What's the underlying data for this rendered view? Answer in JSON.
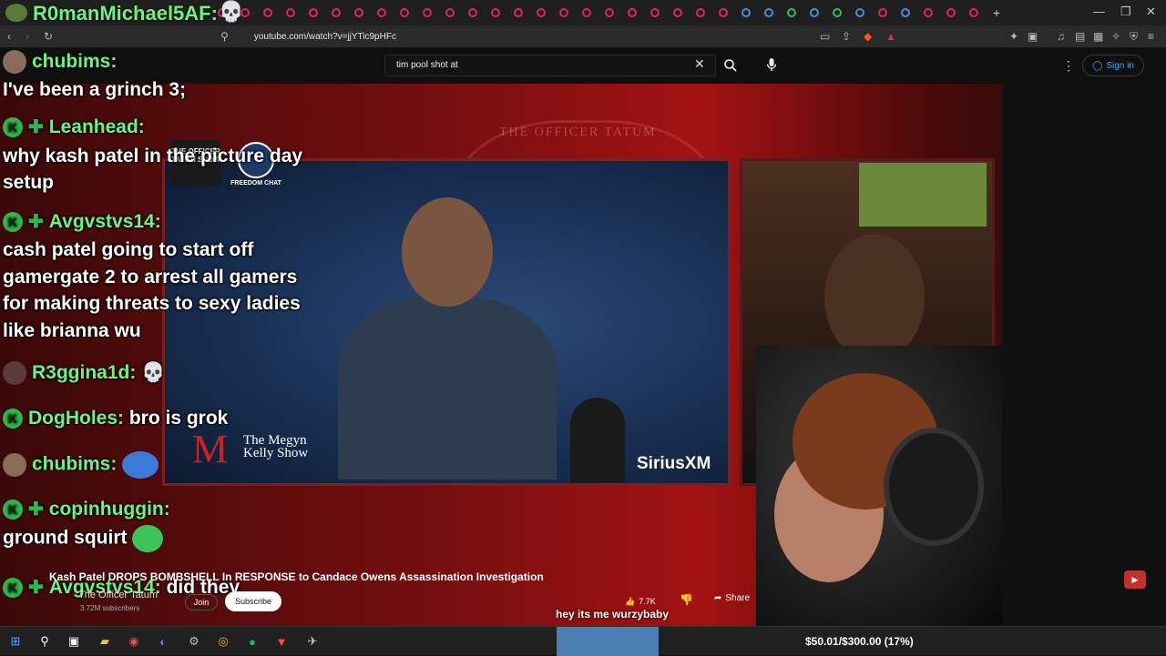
{
  "browser": {
    "url": "youtube.com/watch?v=jjYTic9pHFc",
    "tab_count": 34
  },
  "youtube": {
    "search_value": "tim pool shot at",
    "signin_label": "Sign in",
    "video_title": "Kash Patel DROPS BOMBSHELL In RESPONSE to Candace Owens Assassination Investigation",
    "channel_name": "The Officer Tatum",
    "subscribers": "3.72M subscribers",
    "join_label": "Join",
    "subscribe_label": "Subscribe",
    "like_count": "7.7K",
    "share_label": "Share"
  },
  "video": {
    "seal_text": "THE OFFICER TATUM",
    "watermark": "SiriusXM",
    "show_logo": "The Megyn Kelly Show",
    "show_logo_mark": "M",
    "officer_logo": "THE OFFICER TATUM SHOW",
    "freedom_logo": "FREEDOM CHAT"
  },
  "overlay": {
    "top_user": "R0manMichael5AF:",
    "caption": "hey its me wurzybaby",
    "goal": "$50.01/$300.00 (17%)"
  },
  "chat": [
    {
      "user": "chubims:",
      "message": ""
    },
    {
      "user": "",
      "message": "I've been a grinch 3;"
    },
    {
      "user": "Leanhead:",
      "message": ""
    },
    {
      "user": "",
      "message": "why kash patel in the picture day"
    },
    {
      "user": "",
      "message": "setup"
    },
    {
      "user": "Avgvstvs14:",
      "message": ""
    },
    {
      "user": "",
      "message": "cash patel going to start off"
    },
    {
      "user": "",
      "message": "gamergate 2 to arrest all gamers"
    },
    {
      "user": "",
      "message": "for making threats to sexy ladies"
    },
    {
      "user": "",
      "message": "like brianna wu"
    },
    {
      "user": "R3ggina1d:",
      "message": ""
    },
    {
      "user": "DogHoles:",
      "message": "bro is grok"
    },
    {
      "user": "chubims:",
      "message": ""
    },
    {
      "user": "copinhuggin:",
      "message": ""
    },
    {
      "user": "",
      "message": "ground squirt"
    },
    {
      "user": "Avgvstvs14:",
      "message": "did they"
    }
  ]
}
